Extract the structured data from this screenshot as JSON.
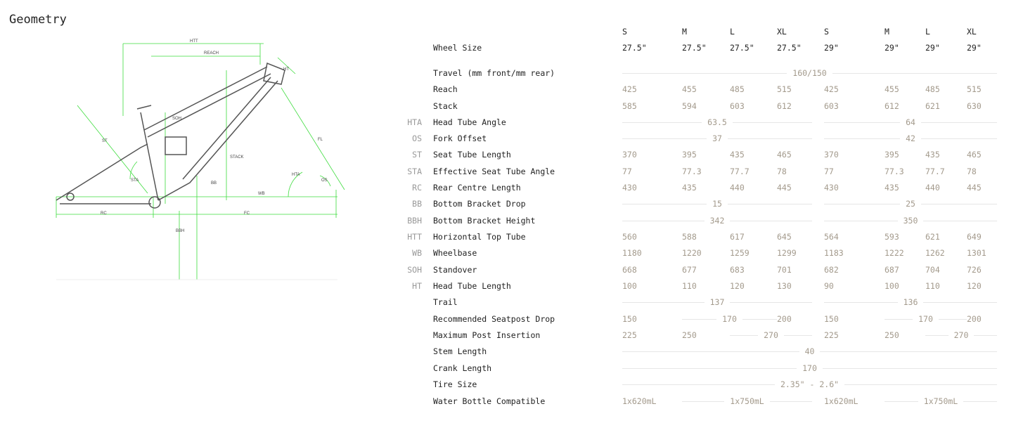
{
  "title": "Geometry",
  "diagram": {
    "labels": [
      "HTT",
      "REACH",
      "HT",
      "ST",
      "SOH",
      "STACK",
      "FL",
      "HTA",
      "OS",
      "STA",
      "BB",
      "WB",
      "RC",
      "FC",
      "BBH"
    ],
    "accent": "#3ddc3d"
  },
  "sizes": [
    "S",
    "M",
    "L",
    "XL",
    "S",
    "M",
    "L",
    "XL"
  ],
  "rows": [
    {
      "abbr": "",
      "label": "Wheel Size",
      "cells": [
        {
          "v": "27.5\""
        },
        {
          "v": "27.5\""
        },
        {
          "v": "27.5\""
        },
        {
          "v": "27.5\""
        },
        {
          "v": "29\""
        },
        {
          "v": "29\""
        },
        {
          "v": "29\""
        },
        {
          "v": "29\""
        }
      ],
      "dark": true
    },
    {
      "abbr": "",
      "label": "Travel (mm front/mm rear)",
      "cells": [
        {
          "v": "160/150",
          "span": 8
        }
      ]
    },
    {
      "abbr": "",
      "label": "Reach",
      "cells": [
        {
          "v": "425"
        },
        {
          "v": "455"
        },
        {
          "v": "485"
        },
        {
          "v": "515"
        },
        {
          "v": "425"
        },
        {
          "v": "455"
        },
        {
          "v": "485"
        },
        {
          "v": "515"
        }
      ]
    },
    {
      "abbr": "",
      "label": "Stack",
      "cells": [
        {
          "v": "585"
        },
        {
          "v": "594"
        },
        {
          "v": "603"
        },
        {
          "v": "612"
        },
        {
          "v": "603"
        },
        {
          "v": "612"
        },
        {
          "v": "621"
        },
        {
          "v": "630"
        }
      ]
    },
    {
      "abbr": "HTA",
      "label": "Head Tube Angle",
      "cells": [
        {
          "v": "63.5",
          "span": 4
        },
        {
          "v": "64",
          "span": 4
        }
      ]
    },
    {
      "abbr": "OS",
      "label": "Fork Offset",
      "cells": [
        {
          "v": "37",
          "span": 4
        },
        {
          "v": "42",
          "span": 4
        }
      ]
    },
    {
      "abbr": "ST",
      "label": "Seat Tube Length",
      "cells": [
        {
          "v": "370"
        },
        {
          "v": "395"
        },
        {
          "v": "435"
        },
        {
          "v": "465"
        },
        {
          "v": "370"
        },
        {
          "v": "395"
        },
        {
          "v": "435"
        },
        {
          "v": "465"
        }
      ]
    },
    {
      "abbr": "STA",
      "label": "Effective Seat Tube Angle",
      "cells": [
        {
          "v": "77"
        },
        {
          "v": "77.3"
        },
        {
          "v": "77.7"
        },
        {
          "v": "78"
        },
        {
          "v": "77"
        },
        {
          "v": "77.3"
        },
        {
          "v": "77.7"
        },
        {
          "v": "78"
        }
      ]
    },
    {
      "abbr": "RC",
      "label": "Rear Centre Length",
      "cells": [
        {
          "v": "430"
        },
        {
          "v": "435"
        },
        {
          "v": "440"
        },
        {
          "v": "445"
        },
        {
          "v": "430"
        },
        {
          "v": "435"
        },
        {
          "v": "440"
        },
        {
          "v": "445"
        }
      ]
    },
    {
      "abbr": "BB",
      "label": "Bottom Bracket Drop",
      "cells": [
        {
          "v": "15",
          "span": 4
        },
        {
          "v": "25",
          "span": 4
        }
      ]
    },
    {
      "abbr": "BBH",
      "label": "Bottom Bracket Height",
      "cells": [
        {
          "v": "342",
          "span": 4
        },
        {
          "v": "350",
          "span": 4
        }
      ]
    },
    {
      "abbr": "HTT",
      "label": "Horizontal Top Tube",
      "cells": [
        {
          "v": "560"
        },
        {
          "v": "588"
        },
        {
          "v": "617"
        },
        {
          "v": "645"
        },
        {
          "v": "564"
        },
        {
          "v": "593"
        },
        {
          "v": "621"
        },
        {
          "v": "649"
        }
      ]
    },
    {
      "abbr": "WB",
      "label": "Wheelbase",
      "cells": [
        {
          "v": "1180"
        },
        {
          "v": "1220"
        },
        {
          "v": "1259"
        },
        {
          "v": "1299"
        },
        {
          "v": "1183"
        },
        {
          "v": "1222"
        },
        {
          "v": "1262"
        },
        {
          "v": "1301"
        }
      ]
    },
    {
      "abbr": "SOH",
      "label": "Standover",
      "cells": [
        {
          "v": "668"
        },
        {
          "v": "677"
        },
        {
          "v": "683"
        },
        {
          "v": "701"
        },
        {
          "v": "682"
        },
        {
          "v": "687"
        },
        {
          "v": "704"
        },
        {
          "v": "726"
        }
      ]
    },
    {
      "abbr": "HT",
      "label": "Head Tube Length",
      "cells": [
        {
          "v": "100"
        },
        {
          "v": "110"
        },
        {
          "v": "120"
        },
        {
          "v": "130"
        },
        {
          "v": "90"
        },
        {
          "v": "100"
        },
        {
          "v": "110"
        },
        {
          "v": "120"
        }
      ]
    },
    {
      "abbr": "",
      "label": "Trail",
      "cells": [
        {
          "v": "137",
          "span": 4
        },
        {
          "v": "136",
          "span": 4
        }
      ]
    },
    {
      "abbr": "",
      "label": "Recommended Seatpost Drop",
      "cells": [
        {
          "v": "150"
        },
        {
          "v": "170",
          "span": 2
        },
        {
          "v": "200"
        },
        {
          "v": "150"
        },
        {
          "v": "170",
          "span": 2
        },
        {
          "v": "200"
        }
      ]
    },
    {
      "abbr": "",
      "label": "Maximum Post Insertion",
      "cells": [
        {
          "v": "225"
        },
        {
          "v": "250"
        },
        {
          "v": "270",
          "span": 2
        },
        {
          "v": "225"
        },
        {
          "v": "250"
        },
        {
          "v": "270",
          "span": 2
        }
      ]
    },
    {
      "abbr": "",
      "label": "Stem Length",
      "cells": [
        {
          "v": "40",
          "span": 8
        }
      ]
    },
    {
      "abbr": "",
      "label": "Crank Length",
      "cells": [
        {
          "v": "170",
          "span": 8
        }
      ]
    },
    {
      "abbr": "",
      "label": "Tire Size",
      "cells": [
        {
          "v": "2.35\" - 2.6\"",
          "span": 8
        }
      ]
    },
    {
      "abbr": "",
      "label": "Water Bottle Compatible",
      "cells": [
        {
          "v": "1x620mL"
        },
        {
          "v": "1x750mL",
          "span": 3
        },
        {
          "v": "1x620mL"
        },
        {
          "v": "1x750mL",
          "span": 3
        }
      ]
    }
  ]
}
